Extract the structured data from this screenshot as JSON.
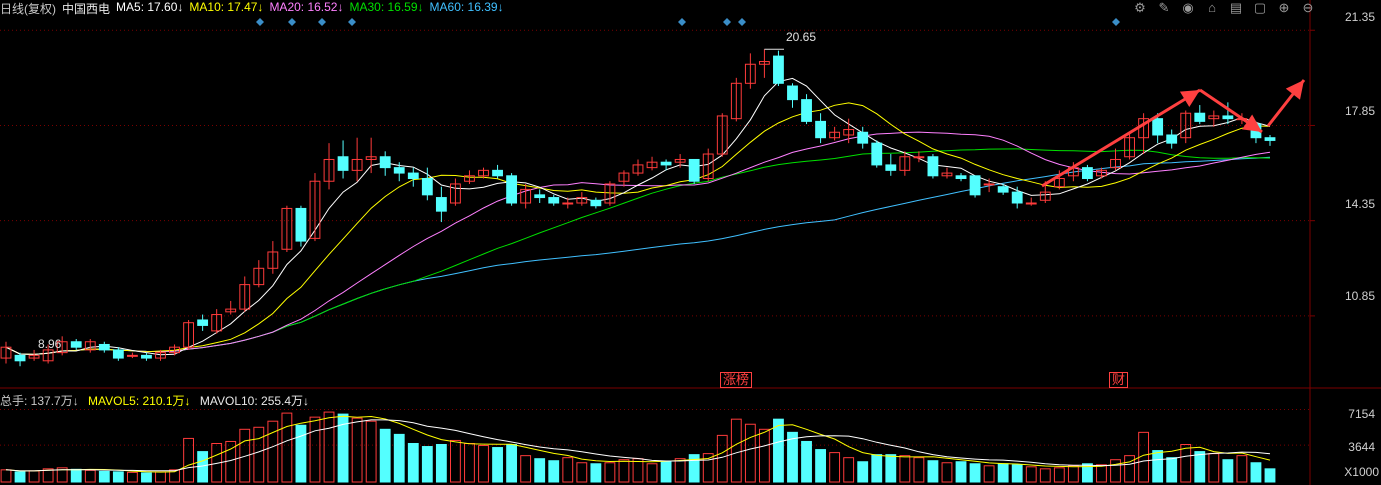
{
  "header": {
    "period": "日线(复权)",
    "stock_name": "中国西电",
    "ma5": "MA5: 17.60↓",
    "ma10": "MA10: 17.47↓",
    "ma20": "MA20: 16.52↓",
    "ma30": "MA30: 16.59↓",
    "ma60": "MA60: 16.39↓"
  },
  "volume_header": {
    "total": "总手: 137.7万↓",
    "mavol5": "MAVOL5: 210.1万↓",
    "mavol10": "MAVOL10: 255.4万↓"
  },
  "toolbar_icons": [
    "gear-icon",
    "brush-icon",
    "eye-icon",
    "shop-icon",
    "clipboard-icon",
    "lock-icon",
    "zoom-in-icon",
    "zoom-out-icon"
  ],
  "colors": {
    "up": "#ff3b3b",
    "down": "#54ffff",
    "ma5": "#ffffff",
    "ma10": "#ffff00",
    "ma20": "#ff80ff",
    "ma30": "#00e000",
    "ma60": "#40c0ff",
    "grid": "#7a0000",
    "diamond": "#3a8ec8",
    "arrow": "#ff4040"
  },
  "chart_data": {
    "type": "candlestick",
    "ylim": [
      8.2,
      21.8
    ],
    "yticks": [
      "21.35",
      "17.85",
      "14.35",
      "10.85"
    ],
    "vol_ticks": [
      "7154",
      "3644"
    ],
    "vol_unit": "X1000",
    "vol_max": 7500,
    "annotations": {
      "high_label": "20.65",
      "low_label": "8.96",
      "marker_1": "涨榜",
      "marker_2": "财"
    },
    "candles": [
      [
        9.3,
        9.7,
        9.9,
        9.1
      ],
      [
        9.4,
        9.2,
        9.5,
        9.0
      ],
      [
        9.3,
        9.4,
        9.6,
        9.2
      ],
      [
        9.2,
        9.6,
        9.8,
        9.1
      ],
      [
        9.5,
        9.9,
        10.1,
        9.4
      ],
      [
        9.9,
        9.7,
        10.0,
        9.6
      ],
      [
        9.6,
        9.9,
        10.0,
        9.5
      ],
      [
        9.8,
        9.6,
        9.9,
        9.5
      ],
      [
        9.6,
        9.3,
        9.7,
        9.2
      ],
      [
        9.4,
        9.4,
        9.5,
        9.3
      ],
      [
        9.4,
        9.3,
        9.5,
        9.2
      ],
      [
        9.3,
        9.5,
        9.6,
        9.2
      ],
      [
        9.5,
        9.7,
        9.8,
        9.4
      ],
      [
        9.7,
        10.6,
        10.7,
        9.6
      ],
      [
        10.7,
        10.5,
        10.9,
        10.3
      ],
      [
        10.3,
        10.9,
        11.1,
        10.2
      ],
      [
        11.0,
        11.1,
        11.4,
        10.9
      ],
      [
        11.1,
        12.0,
        12.3,
        11.0
      ],
      [
        12.0,
        12.6,
        12.9,
        11.9
      ],
      [
        12.6,
        13.2,
        13.6,
        12.4
      ],
      [
        13.3,
        14.8,
        14.9,
        13.2
      ],
      [
        14.8,
        13.6,
        14.9,
        13.4
      ],
      [
        13.7,
        15.8,
        16.1,
        13.6
      ],
      [
        15.8,
        16.6,
        17.2,
        15.5
      ],
      [
        16.7,
        16.2,
        17.3,
        15.9
      ],
      [
        16.2,
        16.6,
        17.4,
        15.8
      ],
      [
        16.6,
        16.7,
        17.4,
        16.1
      ],
      [
        16.7,
        16.3,
        16.9,
        16.0
      ],
      [
        16.3,
        16.1,
        16.5,
        15.8
      ],
      [
        16.1,
        15.9,
        16.3,
        15.6
      ],
      [
        15.9,
        15.3,
        16.3,
        15.1
      ],
      [
        15.2,
        14.7,
        15.6,
        14.3
      ],
      [
        15.0,
        15.7,
        15.9,
        14.9
      ],
      [
        15.8,
        16.0,
        16.2,
        15.7
      ],
      [
        16.0,
        16.2,
        16.3,
        15.9
      ],
      [
        16.2,
        16.0,
        16.4,
        15.9
      ],
      [
        16.0,
        15.0,
        16.1,
        14.9
      ],
      [
        15.0,
        15.5,
        15.7,
        14.8
      ],
      [
        15.3,
        15.2,
        15.5,
        15.0
      ],
      [
        15.2,
        15.0,
        15.3,
        14.9
      ],
      [
        15.0,
        15.0,
        15.2,
        14.8
      ],
      [
        15.0,
        15.2,
        15.4,
        14.9
      ],
      [
        15.1,
        14.9,
        15.2,
        14.8
      ],
      [
        15.0,
        15.7,
        15.8,
        14.9
      ],
      [
        15.8,
        16.1,
        16.2,
        15.6
      ],
      [
        16.1,
        16.4,
        16.6,
        16.0
      ],
      [
        16.3,
        16.5,
        16.7,
        16.2
      ],
      [
        16.5,
        16.4,
        16.6,
        16.2
      ],
      [
        16.5,
        16.6,
        16.8,
        16.3
      ],
      [
        16.6,
        15.8,
        16.6,
        15.7
      ],
      [
        15.9,
        16.8,
        17.0,
        15.8
      ],
      [
        16.8,
        18.2,
        18.3,
        16.7
      ],
      [
        18.1,
        19.4,
        19.6,
        18.0
      ],
      [
        19.4,
        20.1,
        20.5,
        19.2
      ],
      [
        20.1,
        20.2,
        20.65,
        19.6
      ],
      [
        20.4,
        19.4,
        20.6,
        19.3
      ],
      [
        19.3,
        18.8,
        19.4,
        18.5
      ],
      [
        18.8,
        18.0,
        19.0,
        17.9
      ],
      [
        18.0,
        17.4,
        18.3,
        17.2
      ],
      [
        17.4,
        17.6,
        17.8,
        17.3
      ],
      [
        17.5,
        17.7,
        18.1,
        17.2
      ],
      [
        17.6,
        17.2,
        17.8,
        17.0
      ],
      [
        17.2,
        16.4,
        17.3,
        16.3
      ],
      [
        16.4,
        16.2,
        16.8,
        16.0
      ],
      [
        16.2,
        16.7,
        16.9,
        16.0
      ],
      [
        16.7,
        16.7,
        16.9,
        16.5
      ],
      [
        16.7,
        16.0,
        16.8,
        15.9
      ],
      [
        16.0,
        16.1,
        16.3,
        15.9
      ],
      [
        16.0,
        15.9,
        16.1,
        15.8
      ],
      [
        16.0,
        15.3,
        16.0,
        15.2
      ],
      [
        15.7,
        15.7,
        15.9,
        15.4
      ],
      [
        15.6,
        15.4,
        15.7,
        15.3
      ],
      [
        15.4,
        15.0,
        15.6,
        14.8
      ],
      [
        15.0,
        15.0,
        15.2,
        14.9
      ],
      [
        15.1,
        15.4,
        15.8,
        15.0
      ],
      [
        15.6,
        15.9,
        16.2,
        15.5
      ],
      [
        16.0,
        16.3,
        16.5,
        15.8
      ],
      [
        16.3,
        15.9,
        16.4,
        15.8
      ],
      [
        16.0,
        16.2,
        16.3,
        15.9
      ],
      [
        16.3,
        16.6,
        17.0,
        16.2
      ],
      [
        16.7,
        17.4,
        17.6,
        16.6
      ],
      [
        17.4,
        18.1,
        18.3,
        16.8
      ],
      [
        18.1,
        17.5,
        18.3,
        17.2
      ],
      [
        17.5,
        17.2,
        17.7,
        17.0
      ],
      [
        17.4,
        18.3,
        18.4,
        17.2
      ],
      [
        18.3,
        18.0,
        18.6,
        17.9
      ],
      [
        18.1,
        18.2,
        18.4,
        17.8
      ],
      [
        18.2,
        18.1,
        18.7,
        17.9
      ],
      [
        18.1,
        18.1,
        18.3,
        17.9
      ],
      [
        17.9,
        17.4,
        18.0,
        17.2
      ],
      [
        17.4,
        17.3,
        17.5,
        17.1
      ]
    ],
    "volumes": [
      1200,
      1000,
      1100,
      1300,
      1400,
      1250,
      1150,
      1050,
      1000,
      950,
      900,
      1000,
      1200,
      4300,
      3000,
      3800,
      4000,
      5200,
      5400,
      6000,
      6800,
      5600,
      6400,
      6900,
      6700,
      6300,
      6000,
      5200,
      4700,
      3800,
      3500,
      3700,
      4100,
      3800,
      3600,
      3400,
      3700,
      2600,
      2300,
      2100,
      2400,
      1900,
      1800,
      1900,
      2200,
      2300,
      1800,
      2000,
      2300,
      2700,
      2800,
      4600,
      6200,
      5700,
      5200,
      6200,
      4900,
      4000,
      3200,
      2900,
      2400,
      2000,
      2700,
      2700,
      2600,
      2400,
      2100,
      1900,
      2000,
      1800,
      1600,
      1800,
      1700,
      1500,
      1300,
      1400,
      1600,
      1800,
      1700,
      2200,
      2600,
      4900,
      3100,
      2400,
      3700,
      3000,
      2800,
      2200,
      2600,
      1900,
      1300
    ]
  }
}
